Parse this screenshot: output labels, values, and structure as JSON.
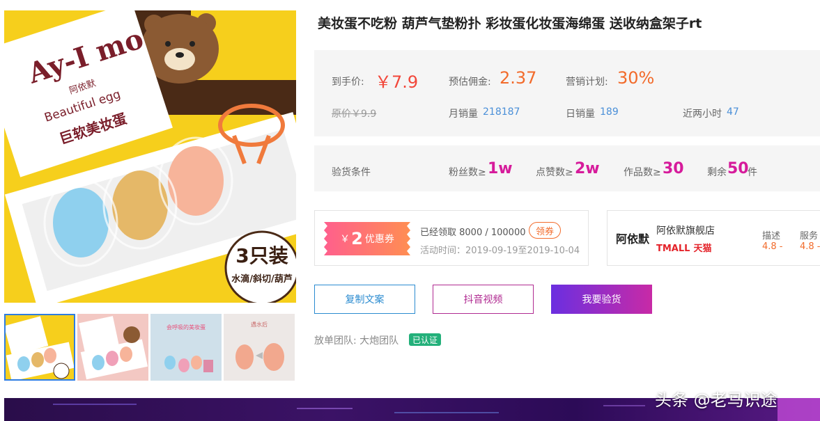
{
  "product": {
    "title": "美妆蛋不吃粉 葫芦气垫粉扑 彩妆蛋化妆蛋海绵蛋 送收纳盒架子rt",
    "image": {
      "brand_logo_text": "Ay-I mo",
      "brand_cn": "阿依默",
      "tagline": "Beautiful egg",
      "box_title": "巨软美妆蛋",
      "badge_main": "3只装",
      "badge_sub": "水滴/斜切/葫芦"
    },
    "thumbnails": [
      {
        "name": "thumb-1",
        "active": true
      },
      {
        "name": "thumb-2",
        "active": false
      },
      {
        "name": "thumb-3",
        "active": false,
        "caption": "会呼吸的美妆蛋"
      },
      {
        "name": "thumb-4",
        "active": false,
        "caption": "遇水后"
      }
    ]
  },
  "price": {
    "final_label": "到手价:",
    "final_value": "￥7.9",
    "commission_label": "预估佣金:",
    "commission_value": "2.37",
    "plan_label": "营销计划:",
    "plan_value": "30%",
    "original_label": "原价",
    "original_value": "￥9.9",
    "monthly_label": "月销量",
    "monthly_value": "218187",
    "daily_label": "日销量",
    "daily_value": "189",
    "two_hours_label": "近两小时",
    "two_hours_value": "47"
  },
  "conditions": {
    "label": "验货条件",
    "fans_prefix": "粉丝数≥",
    "fans_value": "1w",
    "likes_prefix": "点赞数≥",
    "likes_value": "2w",
    "works_prefix": "作品数≥",
    "works_value": "30",
    "remaining_prefix": "剩余",
    "remaining_value": "50",
    "remaining_suffix": "件"
  },
  "coupon": {
    "currency": "￥",
    "amount": "2",
    "label": "优惠券",
    "claimed_text": "已经领取 8000 / 100000",
    "claim_button": "领券",
    "period_text": "活动时间：2019-09-19至2019-10-04"
  },
  "shop": {
    "logo_text": "阿依默",
    "name": "阿依默旗舰店",
    "platform_en": "TMALL",
    "platform_cn": "天猫",
    "score_labels": [
      "描述",
      "服务"
    ],
    "score_values": [
      "4.8 -",
      "4.8 -"
    ]
  },
  "buttons": {
    "copy": "复制文案",
    "video": "抖音视频",
    "check": "我要验货"
  },
  "team": {
    "label": "放单团队: 大炮团队",
    "verified": "已认证"
  },
  "watermark": "头条 @老马识途",
  "colors": {
    "price_red": "#f2473a",
    "accent_orange": "#f26b2b",
    "link_blue": "#4a8fd8",
    "condition_pink": "#d61b9b",
    "verified_green": "#23b07a"
  }
}
